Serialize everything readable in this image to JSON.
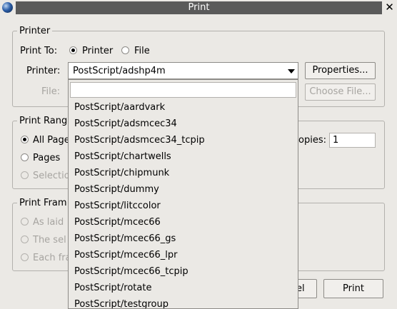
{
  "window": {
    "title": "Print",
    "icon": "app-globe-icon",
    "close_glyph": "✕"
  },
  "printer_group": {
    "legend": "Printer",
    "print_to_label": "Print To:",
    "print_to_options": [
      {
        "label": "Printer",
        "selected": true
      },
      {
        "label": "File",
        "selected": false
      }
    ],
    "printer_label": "Printer:",
    "printer_value": "PostScript/adshp4m",
    "properties_button": "Properties...",
    "file_label": "File:",
    "choose_file_button": "Choose File..."
  },
  "range_group": {
    "legend": "Print Rang",
    "options": [
      {
        "label": "All Page",
        "selected": true,
        "enabled": true
      },
      {
        "label": "Pages",
        "selected": false,
        "enabled": true
      },
      {
        "label": "Selectio",
        "selected": false,
        "enabled": false
      }
    ],
    "copies_label": "opies:",
    "copies_value": "1"
  },
  "frames_group": {
    "legend": "Print Fram",
    "options": [
      {
        "label": "As laid"
      },
      {
        "label": "The sel"
      },
      {
        "label": "Each fra"
      }
    ]
  },
  "footer": {
    "cancel_button_partial": "el",
    "print_button": "Print"
  },
  "dropdown": {
    "filter_value": "",
    "items": [
      "PostScript/aardvark",
      "PostScript/adsmcec34",
      "PostScript/adsmcec34_tcpip",
      "PostScript/chartwells",
      "PostScript/chipmunk",
      "PostScript/dummy",
      "PostScript/litccolor",
      "PostScript/mcec66",
      "PostScript/mcec66_gs",
      "PostScript/mcec66_lpr",
      "PostScript/mcec66_tcpip",
      "PostScript/rotate",
      "PostScript/testgroup"
    ]
  },
  "colors": {
    "background": "#ebe9e5",
    "titlebar": "#5a5a5a",
    "disabled_text": "#a6a4a0"
  }
}
